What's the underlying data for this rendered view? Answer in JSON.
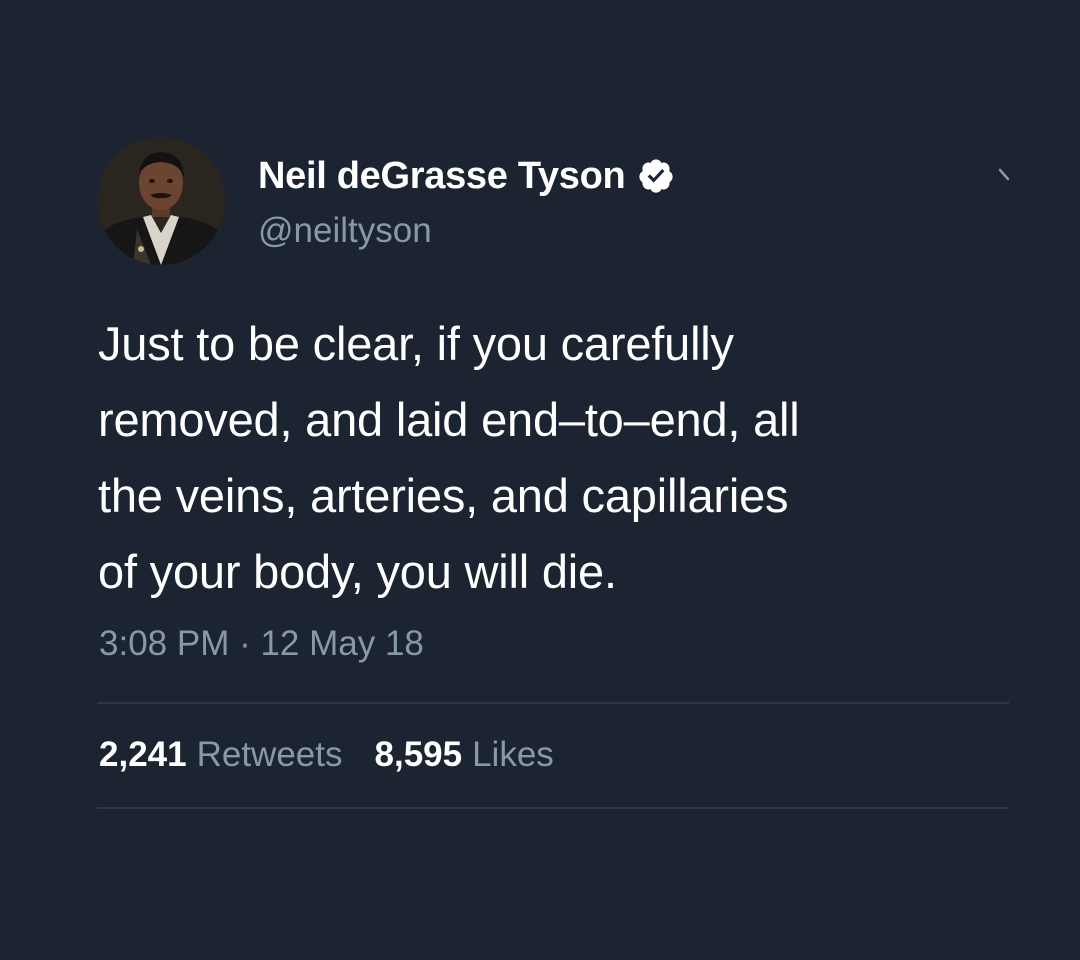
{
  "tweet": {
    "display_name": "Neil deGrasse Tyson",
    "handle": "@neiltyson",
    "verified": true,
    "text": "Just to be clear, if you carefully\nremoved, and laid end–to–end, all\nthe veins, arteries, and capillaries\nof your body, you will die.",
    "timestamp": "3:08 PM · 12 May 18",
    "retweets": {
      "count": "2,241",
      "label": "Retweets"
    },
    "likes": {
      "count": "8,595",
      "label": "Likes"
    }
  },
  "icons": {
    "verified": "verified-badge-icon",
    "menu": "chevron-down-icon"
  },
  "colors": {
    "background": "#1b2430",
    "primary_text": "#ffffff",
    "secondary_text": "#8899a6",
    "divider": "#2b3845"
  }
}
